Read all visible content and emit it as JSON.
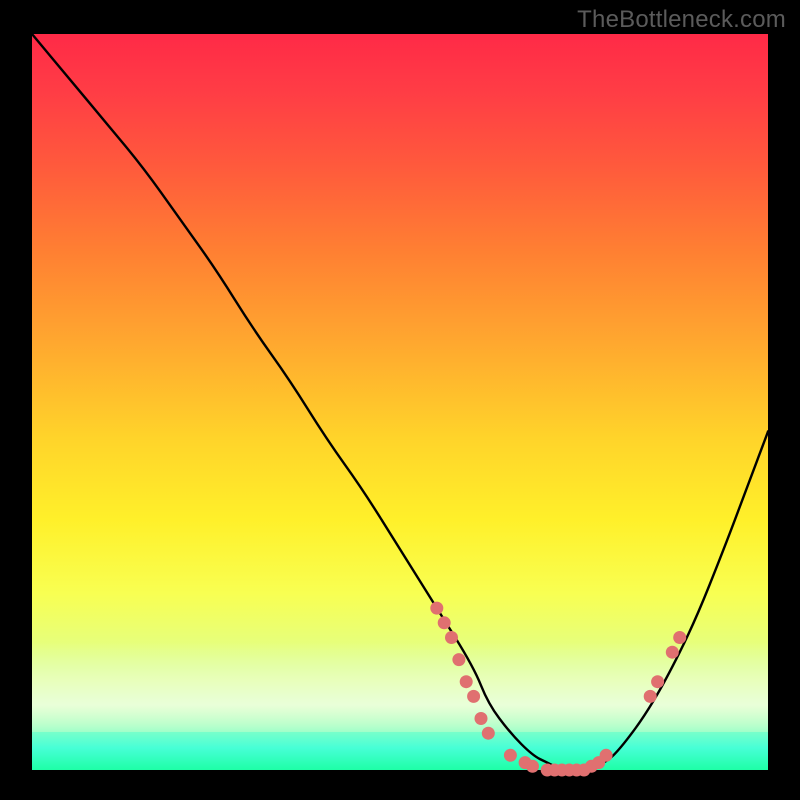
{
  "watermark": "TheBottleneck.com",
  "colors": {
    "background": "#000000",
    "gradient_top": "#ff2a47",
    "gradient_bottom": "#1effa6",
    "curve": "#000000",
    "markers": "#e07070",
    "watermark_text": "#5b5b5b"
  },
  "chart_data": {
    "type": "line",
    "title": "",
    "xlabel": "",
    "ylabel": "",
    "xlim": [
      0,
      100
    ],
    "ylim": [
      0,
      100
    ],
    "grid": false,
    "legend": false,
    "series": [
      {
        "name": "bottleneck-curve",
        "x": [
          0,
          5,
          10,
          15,
          20,
          25,
          30,
          35,
          40,
          45,
          50,
          55,
          60,
          62,
          65,
          68,
          70,
          72,
          75,
          78,
          80,
          83,
          86,
          90,
          94,
          97,
          100
        ],
        "y": [
          100,
          94,
          88,
          82,
          75,
          68,
          60,
          53,
          45,
          38,
          30,
          22,
          14,
          9,
          5,
          2,
          1,
          0,
          0,
          1,
          3,
          7,
          12,
          20,
          30,
          38,
          46
        ]
      }
    ],
    "markers": [
      {
        "x": 55,
        "y": 22
      },
      {
        "x": 56,
        "y": 20
      },
      {
        "x": 57,
        "y": 18
      },
      {
        "x": 58,
        "y": 15
      },
      {
        "x": 59,
        "y": 12
      },
      {
        "x": 60,
        "y": 10
      },
      {
        "x": 61,
        "y": 7
      },
      {
        "x": 62,
        "y": 5
      },
      {
        "x": 65,
        "y": 2
      },
      {
        "x": 67,
        "y": 1
      },
      {
        "x": 68,
        "y": 0.5
      },
      {
        "x": 70,
        "y": 0
      },
      {
        "x": 71,
        "y": 0
      },
      {
        "x": 72,
        "y": 0
      },
      {
        "x": 73,
        "y": 0
      },
      {
        "x": 74,
        "y": 0
      },
      {
        "x": 75,
        "y": 0
      },
      {
        "x": 76,
        "y": 0.5
      },
      {
        "x": 77,
        "y": 1
      },
      {
        "x": 78,
        "y": 2
      },
      {
        "x": 84,
        "y": 10
      },
      {
        "x": 85,
        "y": 12
      },
      {
        "x": 87,
        "y": 16
      },
      {
        "x": 88,
        "y": 18
      }
    ],
    "annotations": []
  }
}
